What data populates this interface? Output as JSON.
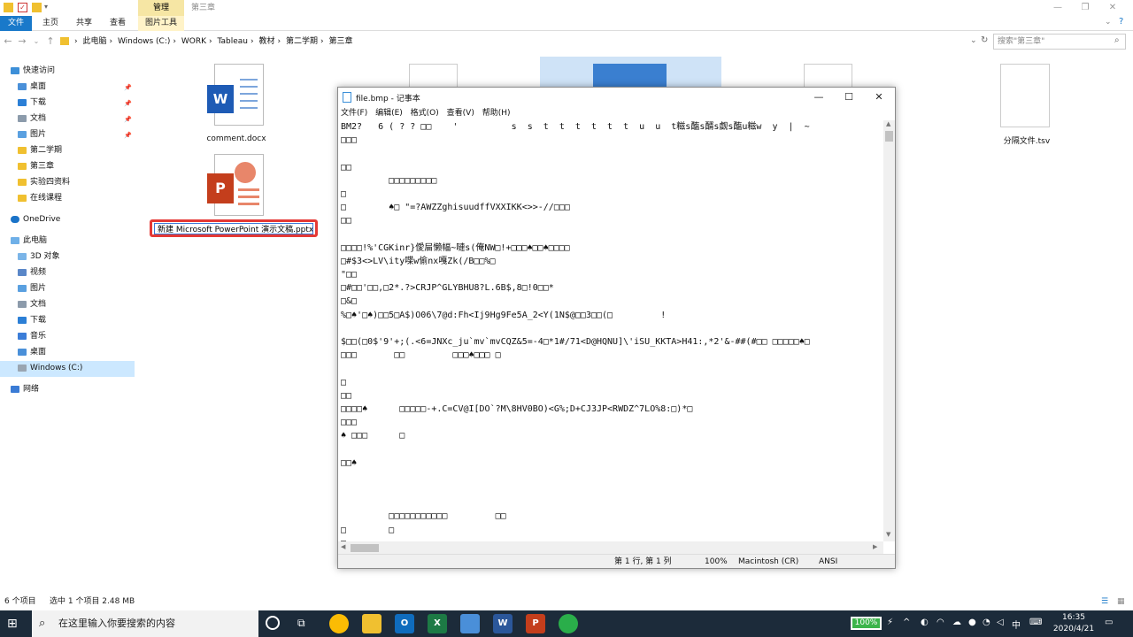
{
  "explorer": {
    "window_title": "第三章",
    "ribbon_contextual_group": "管理",
    "ribbon_tabs": [
      "文件",
      "主页",
      "共享",
      "查看",
      "图片工具"
    ],
    "breadcrumb": [
      "此电脑",
      "Windows (C:)",
      "WORK",
      "Tableau",
      "教材",
      "第二学期",
      "第三章"
    ],
    "search_placeholder": "搜索\"第三章\"",
    "nav_pane": {
      "quick_access": "快速访问",
      "quick_items": [
        {
          "label": "桌面",
          "pinned": true
        },
        {
          "label": "下载",
          "pinned": true
        },
        {
          "label": "文档",
          "pinned": true
        },
        {
          "label": "图片",
          "pinned": true
        },
        {
          "label": "第二学期",
          "pinned": false
        },
        {
          "label": "第三章",
          "pinned": false
        },
        {
          "label": "实验四资料",
          "pinned": false
        },
        {
          "label": "在线课程",
          "pinned": false
        }
      ],
      "onedrive": "OneDrive",
      "this_pc": "此电脑",
      "pc_items": [
        "3D 对象",
        "视频",
        "图片",
        "文档",
        "下载",
        "音乐",
        "桌面",
        "Windows (C:)"
      ],
      "network": "网络"
    },
    "files": {
      "word_doc": "comment.docx",
      "tsv_file": "分隔文件.tsv",
      "pptx_rename_value": "新建 Microsoft PowerPoint 演示文稿.pptx"
    },
    "status_bar": {
      "item_count": "6 个项目",
      "selection": "选中 1 个项目  2.48 MB"
    }
  },
  "notepad": {
    "title": "file.bmp - 记事本",
    "menu": [
      "文件(F)",
      "编辑(E)",
      "格式(O)",
      "查看(V)",
      "帮助(H)"
    ],
    "lines": [
      "BM2?   6 ( ? ? □□    '          s  s  t  t  t  t  t  t  u  u  t糍s醢s醑s觑s醢u糍w  y  |  ~",
      "□□□",
      "",
      "□□",
      "         □□□□□□□□□",
      "□",
      "□        ♠□ \"=?AWZZghisuudffVXXIKK<>>-//□□□",
      "□□",
      "",
      "□□□□!%'CGKinr}僾屇懒幅~嗹s(俺NW□!+□□□♠□□♠□□□□",
      "□#$3<>LV\\ity喋w偷nx嘎Zk(/B□□%□",
      "\"□□",
      "□#□□'□□,□2*.?>CRJP^GLYBHU8?L.6B$,8□!0□□*",
      "□&□",
      "%□♠'□♠)□□5□A$)O06\\7@d:Fh<Ij9Hg9Fe5A_2<Y(1N$@□□3□□(□         !",
      "",
      "$□□(□0$'9'+;(.<6=JNXc_ju`mv`mvCQZ&5=-4□*1#/71<D@HQNU]\\'iSU_KKTA>H41:,*2'&-##(#□□ □□□□□♠□",
      "□□□       □□         □□□♠□□□ □",
      "",
      "□",
      "□□",
      "□□□□♠      □□□□□-+.C=CV@I[DO`?M\\8HV0BO)<G%;D+CJ3JP<RWDZ^7LO%8:□)*□",
      "□□□",
      "♠ □□□      □",
      "",
      "□□♠",
      "",
      "",
      "",
      "         □□□□□□□□□□□         □□",
      "□        □",
      "□"
    ],
    "status": {
      "position": "第 1 行, 第 1 列",
      "zoom": "100%",
      "line_ending": "Macintosh (CR)",
      "encoding": "ANSI"
    }
  },
  "taskbar": {
    "search_placeholder": "在这里输入你要搜索的内容",
    "battery": "100%",
    "ime": "中",
    "time": "16:35",
    "date": "2020/4/21"
  }
}
